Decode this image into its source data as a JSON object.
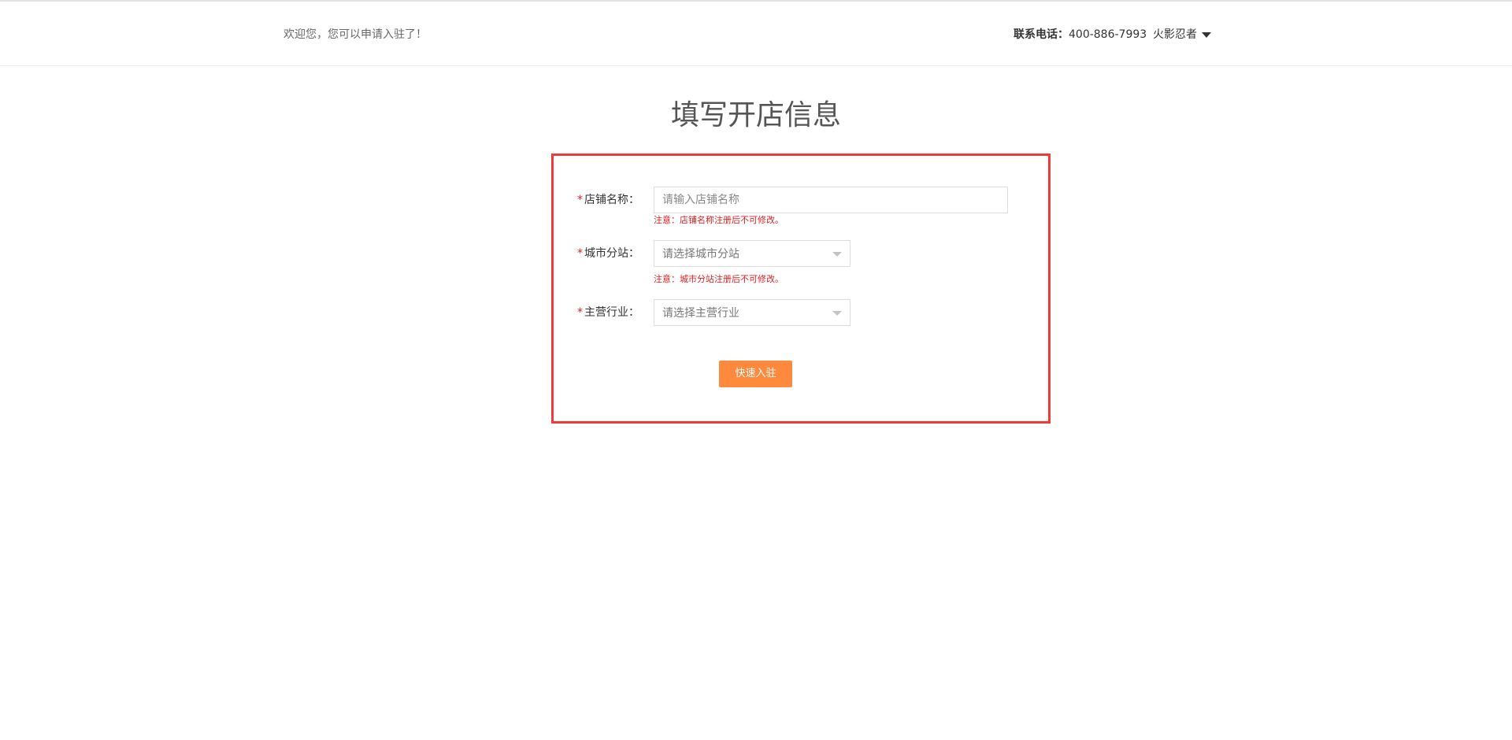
{
  "header": {
    "welcome_text": "欢迎您，您可以申请入驻了！",
    "contact_label": "联系电话：",
    "contact_phone": "400-886-7993",
    "username": "火影忍者"
  },
  "page": {
    "title": "填写开店信息"
  },
  "form": {
    "shop_name": {
      "label": "店铺名称：",
      "placeholder": "请输入店铺名称",
      "value": "",
      "notice": "注意：店铺名称注册后不可修改。"
    },
    "city_station": {
      "label": "城市分站：",
      "selected": "请选择城市分站",
      "notice": "注意：城市分站注册后不可修改。"
    },
    "main_industry": {
      "label": "主营行业：",
      "selected": "请选择主营行业"
    },
    "required_mark": "*",
    "submit_label": "快速入驻"
  },
  "colors": {
    "accent": "#ff8a3d",
    "error": "#e02020",
    "highlight_border": "#f03b3b"
  }
}
